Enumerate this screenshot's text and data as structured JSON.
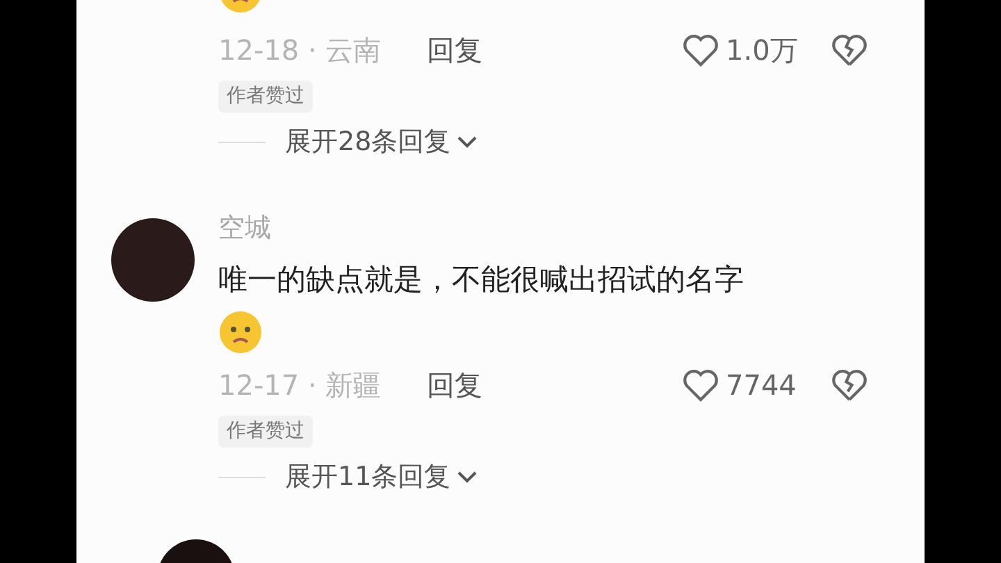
{
  "comments": [
    {
      "kind": "cut",
      "meta": "12-18 · 云南",
      "reply": "回复",
      "likes": "1.0万",
      "badge": "作者赞过",
      "expand": "展开28条回复"
    },
    {
      "kind": "full",
      "name": "空城",
      "text": "唯一的缺点就是，不能很喊出招试的名字",
      "meta": "12-17 · 新疆",
      "reply": "回复",
      "likes": "7744",
      "badge": "作者赞过",
      "expand": "展开11条回复"
    },
    {
      "kind": "avatar_only"
    }
  ]
}
